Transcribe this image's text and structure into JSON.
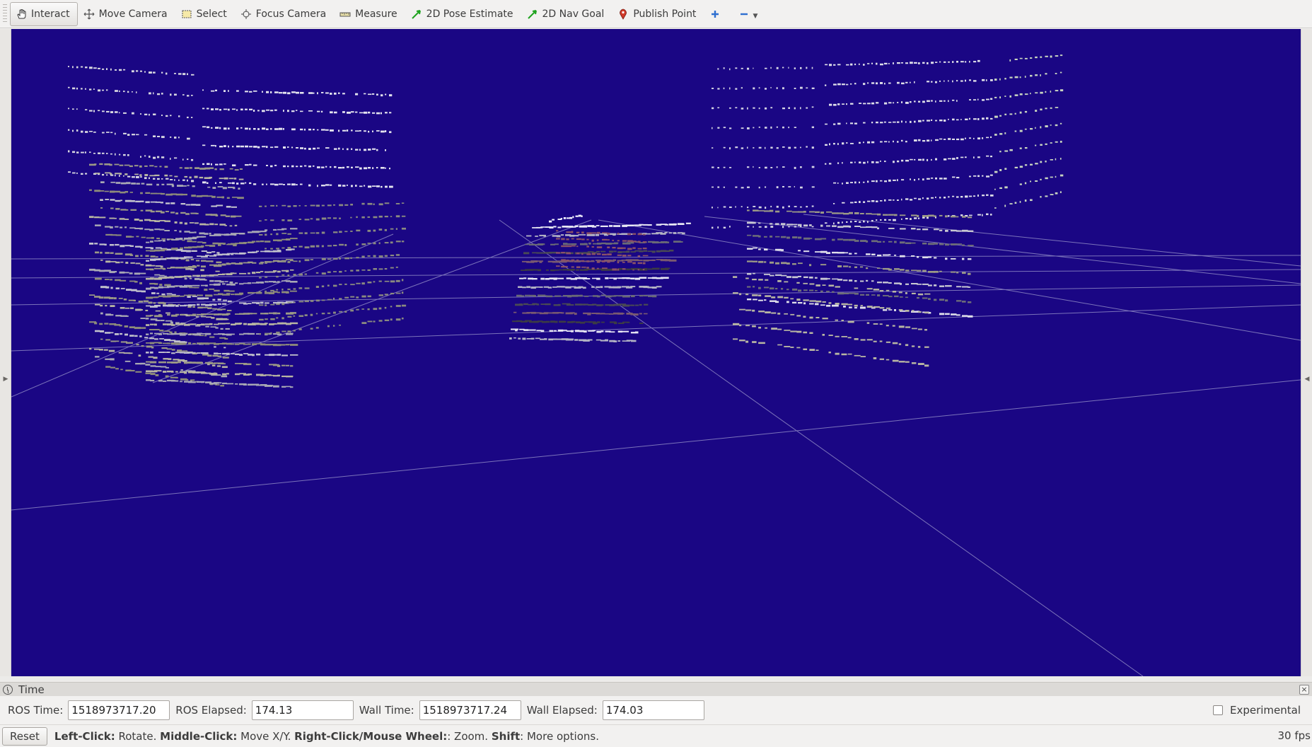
{
  "toolbar": {
    "tools": [
      {
        "label": "Interact",
        "icon": "hand-icon",
        "active": true
      },
      {
        "label": "Move Camera",
        "icon": "move-camera-icon"
      },
      {
        "label": "Select",
        "icon": "select-icon"
      },
      {
        "label": "Focus Camera",
        "icon": "focus-camera-icon"
      },
      {
        "label": "Measure",
        "icon": "ruler-icon"
      },
      {
        "label": "2D Pose Estimate",
        "icon": "green-arrow-icon"
      },
      {
        "label": "2D Nav Goal",
        "icon": "green-arrow-icon"
      },
      {
        "label": "Publish Point",
        "icon": "map-pin-icon"
      }
    ],
    "add_icon": "plus-icon",
    "remove_icon": "minus-icon"
  },
  "viewport": {
    "background": "#1a0684",
    "grid_color": "#8c86c4"
  },
  "time_panel": {
    "title": "Time",
    "ros_time_label": "ROS Time:",
    "ros_time_value": "1518973717.20",
    "ros_elapsed_label": "ROS Elapsed:",
    "ros_elapsed_value": "174.13",
    "wall_time_label": "Wall Time:",
    "wall_time_value": "1518973717.24",
    "wall_elapsed_label": "Wall Elapsed:",
    "wall_elapsed_value": "174.03",
    "experimental_label": "Experimental",
    "experimental_checked": false
  },
  "status_bar": {
    "reset_label": "Reset",
    "left_click_key": "Left-Click:",
    "left_click_desc": " Rotate. ",
    "middle_click_key": "Middle-Click:",
    "middle_click_desc": " Move X/Y. ",
    "right_click_key": "Right-Click/Mouse Wheel:",
    "right_click_desc": ": Zoom. ",
    "shift_key": "Shift",
    "shift_desc": ": More options.",
    "fps": "30 fps"
  }
}
